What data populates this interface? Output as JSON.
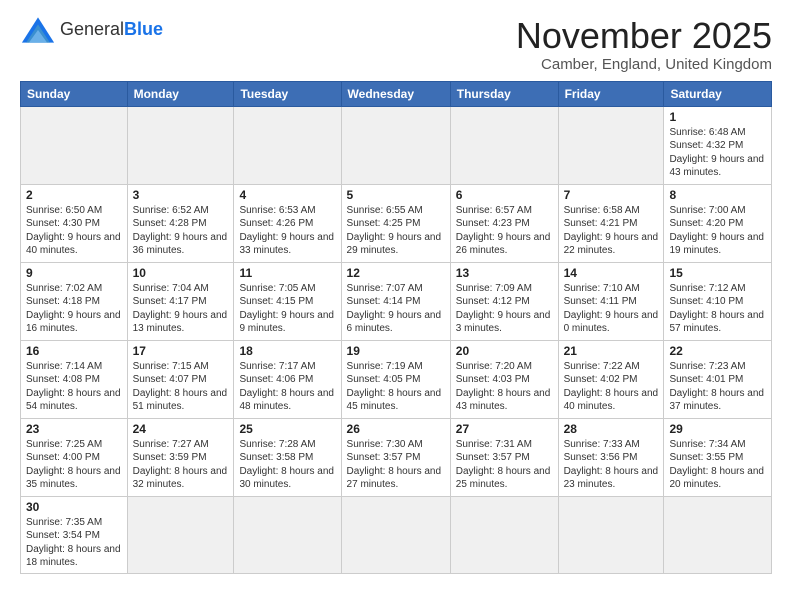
{
  "header": {
    "logo_general": "General",
    "logo_blue": "Blue",
    "month_title": "November 2025",
    "location": "Camber, England, United Kingdom"
  },
  "weekdays": [
    "Sunday",
    "Monday",
    "Tuesday",
    "Wednesday",
    "Thursday",
    "Friday",
    "Saturday"
  ],
  "weeks": [
    [
      {
        "day": "",
        "info": ""
      },
      {
        "day": "",
        "info": ""
      },
      {
        "day": "",
        "info": ""
      },
      {
        "day": "",
        "info": ""
      },
      {
        "day": "",
        "info": ""
      },
      {
        "day": "",
        "info": ""
      },
      {
        "day": "1",
        "info": "Sunrise: 6:48 AM\nSunset: 4:32 PM\nDaylight: 9 hours and 43 minutes."
      }
    ],
    [
      {
        "day": "2",
        "info": "Sunrise: 6:50 AM\nSunset: 4:30 PM\nDaylight: 9 hours and 40 minutes."
      },
      {
        "day": "3",
        "info": "Sunrise: 6:52 AM\nSunset: 4:28 PM\nDaylight: 9 hours and 36 minutes."
      },
      {
        "day": "4",
        "info": "Sunrise: 6:53 AM\nSunset: 4:26 PM\nDaylight: 9 hours and 33 minutes."
      },
      {
        "day": "5",
        "info": "Sunrise: 6:55 AM\nSunset: 4:25 PM\nDaylight: 9 hours and 29 minutes."
      },
      {
        "day": "6",
        "info": "Sunrise: 6:57 AM\nSunset: 4:23 PM\nDaylight: 9 hours and 26 minutes."
      },
      {
        "day": "7",
        "info": "Sunrise: 6:58 AM\nSunset: 4:21 PM\nDaylight: 9 hours and 22 minutes."
      },
      {
        "day": "8",
        "info": "Sunrise: 7:00 AM\nSunset: 4:20 PM\nDaylight: 9 hours and 19 minutes."
      }
    ],
    [
      {
        "day": "9",
        "info": "Sunrise: 7:02 AM\nSunset: 4:18 PM\nDaylight: 9 hours and 16 minutes."
      },
      {
        "day": "10",
        "info": "Sunrise: 7:04 AM\nSunset: 4:17 PM\nDaylight: 9 hours and 13 minutes."
      },
      {
        "day": "11",
        "info": "Sunrise: 7:05 AM\nSunset: 4:15 PM\nDaylight: 9 hours and 9 minutes."
      },
      {
        "day": "12",
        "info": "Sunrise: 7:07 AM\nSunset: 4:14 PM\nDaylight: 9 hours and 6 minutes."
      },
      {
        "day": "13",
        "info": "Sunrise: 7:09 AM\nSunset: 4:12 PM\nDaylight: 9 hours and 3 minutes."
      },
      {
        "day": "14",
        "info": "Sunrise: 7:10 AM\nSunset: 4:11 PM\nDaylight: 9 hours and 0 minutes."
      },
      {
        "day": "15",
        "info": "Sunrise: 7:12 AM\nSunset: 4:10 PM\nDaylight: 8 hours and 57 minutes."
      }
    ],
    [
      {
        "day": "16",
        "info": "Sunrise: 7:14 AM\nSunset: 4:08 PM\nDaylight: 8 hours and 54 minutes."
      },
      {
        "day": "17",
        "info": "Sunrise: 7:15 AM\nSunset: 4:07 PM\nDaylight: 8 hours and 51 minutes."
      },
      {
        "day": "18",
        "info": "Sunrise: 7:17 AM\nSunset: 4:06 PM\nDaylight: 8 hours and 48 minutes."
      },
      {
        "day": "19",
        "info": "Sunrise: 7:19 AM\nSunset: 4:05 PM\nDaylight: 8 hours and 45 minutes."
      },
      {
        "day": "20",
        "info": "Sunrise: 7:20 AM\nSunset: 4:03 PM\nDaylight: 8 hours and 43 minutes."
      },
      {
        "day": "21",
        "info": "Sunrise: 7:22 AM\nSunset: 4:02 PM\nDaylight: 8 hours and 40 minutes."
      },
      {
        "day": "22",
        "info": "Sunrise: 7:23 AM\nSunset: 4:01 PM\nDaylight: 8 hours and 37 minutes."
      }
    ],
    [
      {
        "day": "23",
        "info": "Sunrise: 7:25 AM\nSunset: 4:00 PM\nDaylight: 8 hours and 35 minutes."
      },
      {
        "day": "24",
        "info": "Sunrise: 7:27 AM\nSunset: 3:59 PM\nDaylight: 8 hours and 32 minutes."
      },
      {
        "day": "25",
        "info": "Sunrise: 7:28 AM\nSunset: 3:58 PM\nDaylight: 8 hours and 30 minutes."
      },
      {
        "day": "26",
        "info": "Sunrise: 7:30 AM\nSunset: 3:57 PM\nDaylight: 8 hours and 27 minutes."
      },
      {
        "day": "27",
        "info": "Sunrise: 7:31 AM\nSunset: 3:57 PM\nDaylight: 8 hours and 25 minutes."
      },
      {
        "day": "28",
        "info": "Sunrise: 7:33 AM\nSunset: 3:56 PM\nDaylight: 8 hours and 23 minutes."
      },
      {
        "day": "29",
        "info": "Sunrise: 7:34 AM\nSunset: 3:55 PM\nDaylight: 8 hours and 20 minutes."
      }
    ],
    [
      {
        "day": "30",
        "info": "Sunrise: 7:35 AM\nSunset: 3:54 PM\nDaylight: 8 hours and 18 minutes."
      },
      {
        "day": "",
        "info": ""
      },
      {
        "day": "",
        "info": ""
      },
      {
        "day": "",
        "info": ""
      },
      {
        "day": "",
        "info": ""
      },
      {
        "day": "",
        "info": ""
      },
      {
        "day": "",
        "info": ""
      }
    ]
  ]
}
